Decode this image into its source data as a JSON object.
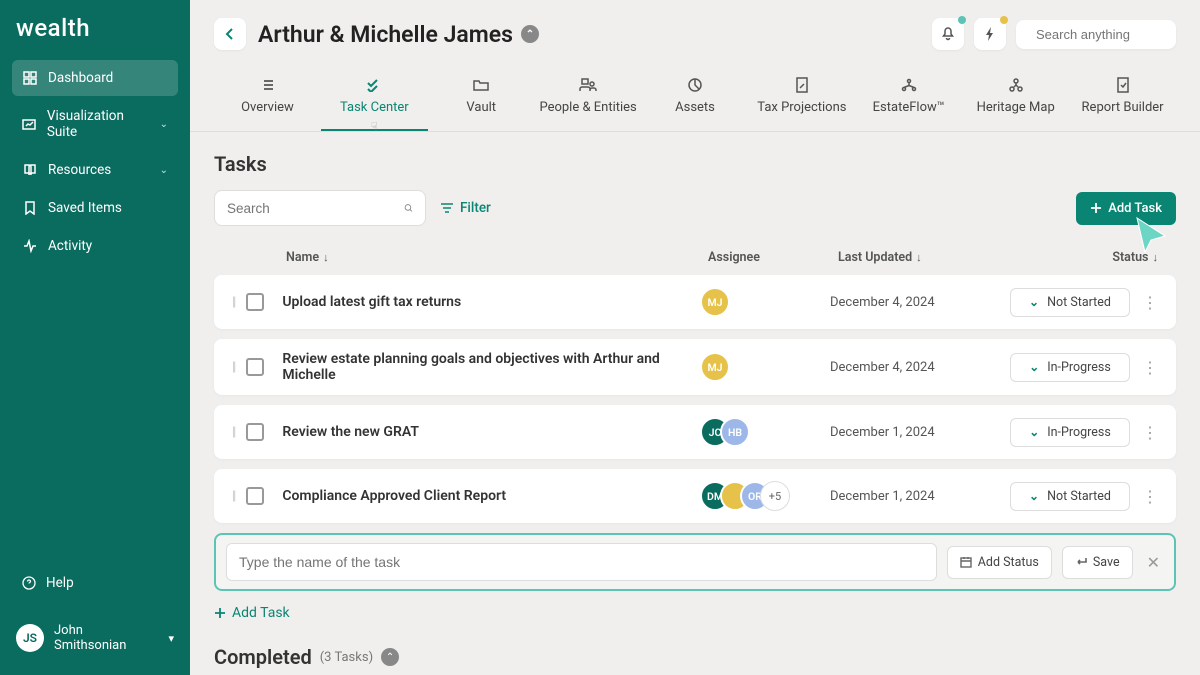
{
  "brand": "wealth",
  "sidebar": {
    "items": [
      {
        "label": "Dashboard"
      },
      {
        "label": "Visualization Suite"
      },
      {
        "label": "Resources"
      },
      {
        "label": "Saved Items"
      },
      {
        "label": "Activity"
      }
    ],
    "help": "Help",
    "user": {
      "initials": "JS",
      "name": "John Smithsonian"
    }
  },
  "header": {
    "client_name": "Arthur & Michelle James",
    "search_placeholder": "Search anything"
  },
  "tabs": [
    {
      "label": "Overview"
    },
    {
      "label": "Task Center"
    },
    {
      "label": "Vault"
    },
    {
      "label": "People & Entities"
    },
    {
      "label": "Assets"
    },
    {
      "label": "Tax Projections"
    },
    {
      "label": "EstateFlow™"
    },
    {
      "label": "Heritage Map"
    },
    {
      "label": "Report Builder"
    }
  ],
  "tasks_section": {
    "title": "Tasks",
    "search_placeholder": "Search",
    "filter_label": "Filter",
    "add_task_button": "Add Task",
    "columns": {
      "name": "Name",
      "assignee": "Assignee",
      "updated": "Last Updated",
      "status": "Status"
    },
    "rows": [
      {
        "name": "Upload latest gift tax returns",
        "assignees": [
          {
            "initials": "MJ",
            "bg": "#e6c24a"
          }
        ],
        "updated": "December 4, 2024",
        "status": "Not Started"
      },
      {
        "name": "Review estate planning goals and objectives with Arthur and Michelle",
        "assignees": [
          {
            "initials": "MJ",
            "bg": "#e6c24a"
          }
        ],
        "updated": "December 4, 2024",
        "status": "In-Progress"
      },
      {
        "name": "Review the new GRAT",
        "assignees": [
          {
            "initials": "JC",
            "bg": "#0a6b5f"
          },
          {
            "initials": "HB",
            "bg": "#9db8e8"
          }
        ],
        "updated": "December 1, 2024",
        "status": "In-Progress"
      },
      {
        "name": "Compliance Approved Client Report",
        "assignees": [
          {
            "initials": "DM",
            "bg": "#0a6b5f"
          },
          {
            "initials": "",
            "bg": "#e6c24a"
          },
          {
            "initials": "OR",
            "bg": "#9db8e8"
          }
        ],
        "more": "+5",
        "updated": "December 1, 2024",
        "status": "Not Started"
      }
    ],
    "new_task_placeholder": "Type the name of the task",
    "add_status_label": "Add Status",
    "save_label": "Save",
    "add_task_link": "Add Task"
  },
  "completed_section": {
    "title": "Completed",
    "count": "(3 Tasks)"
  },
  "colors": {
    "brand": "#0a8573",
    "sidebar": "#0a6b5f"
  }
}
